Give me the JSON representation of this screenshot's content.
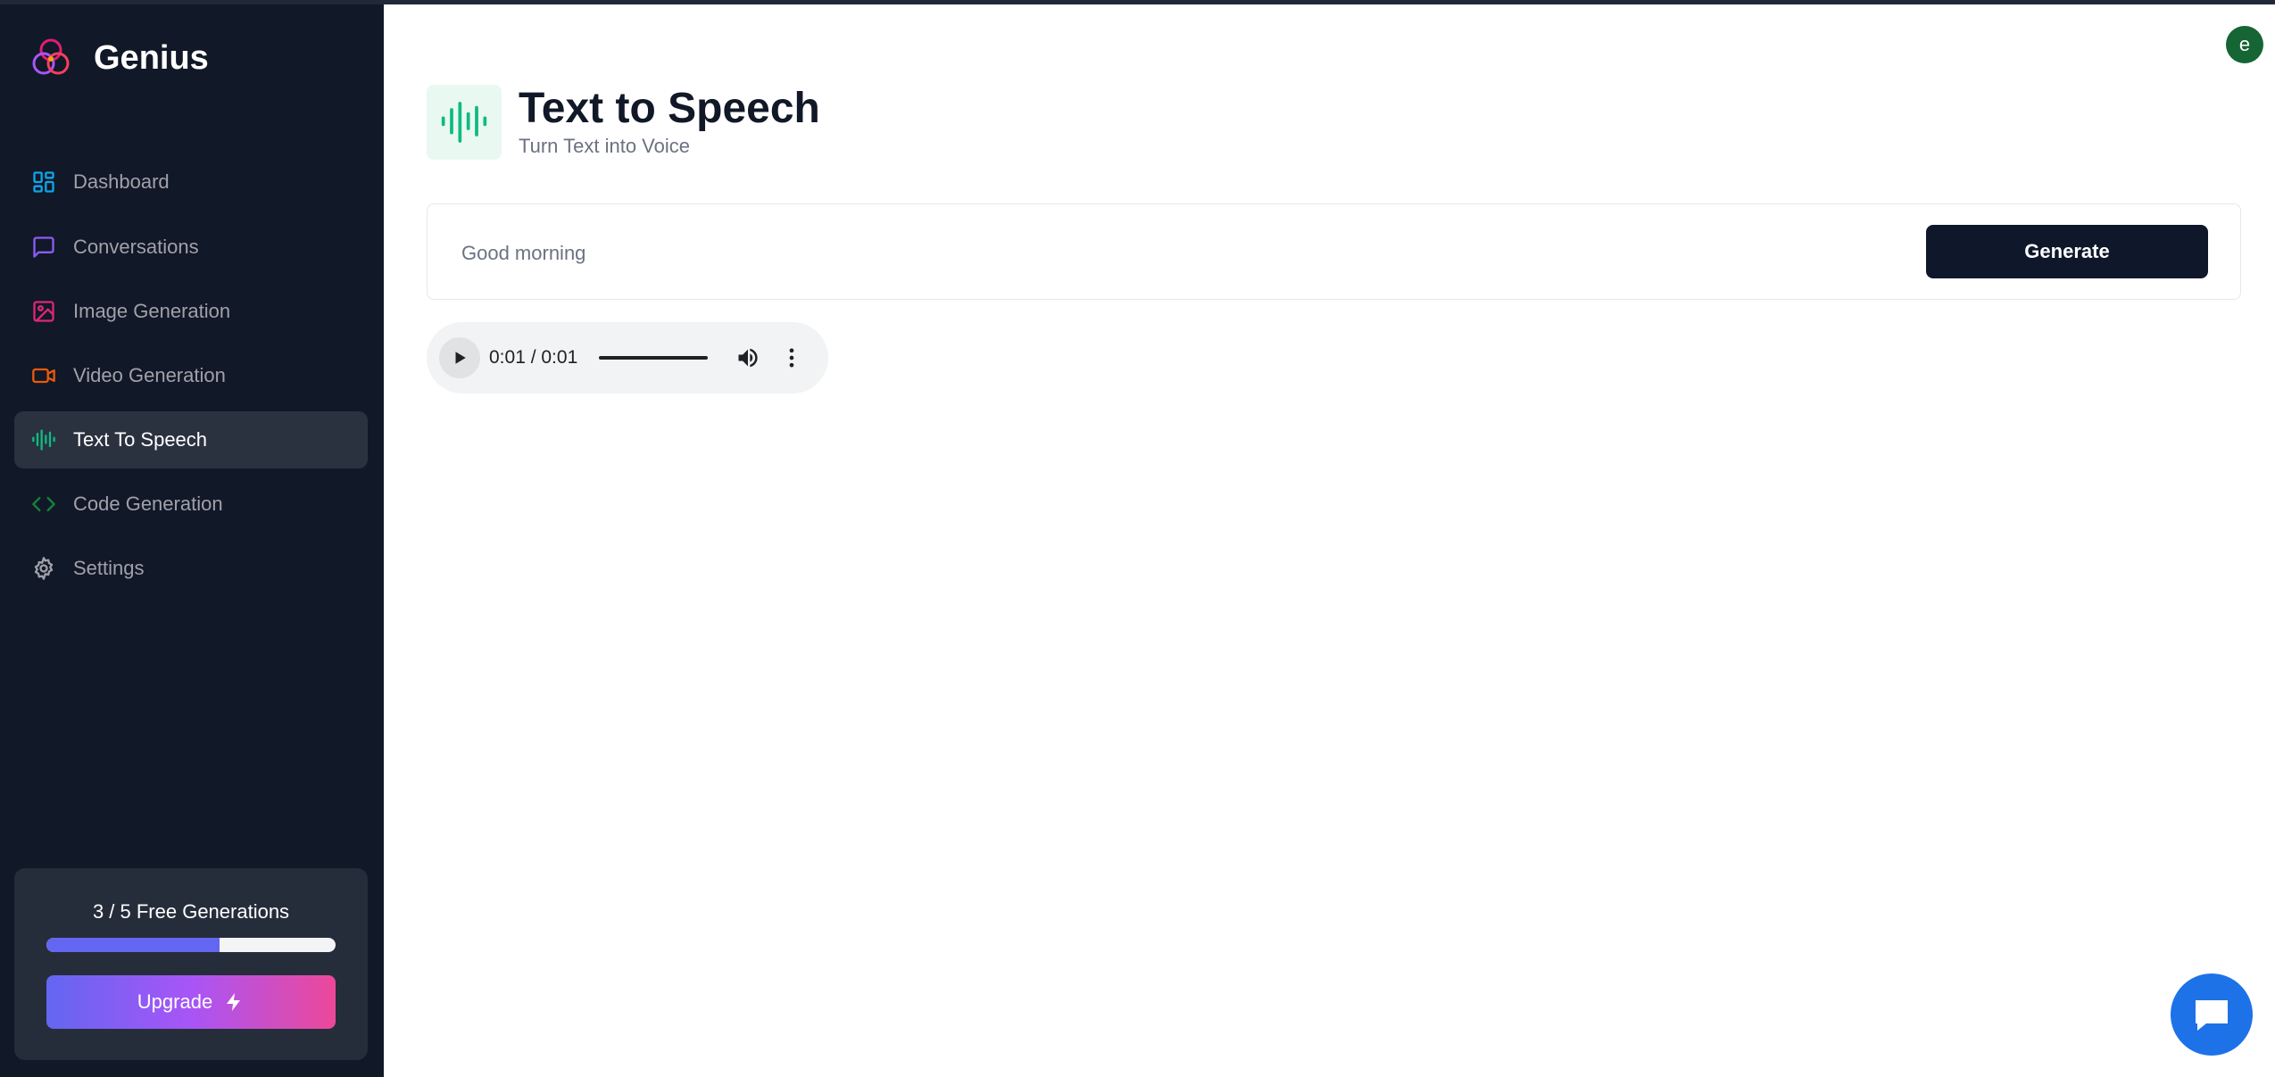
{
  "app": {
    "name": "Genius"
  },
  "sidebar": {
    "items": [
      {
        "label": "Dashboard",
        "icon": "dashboard-icon",
        "color": "#0ea5e9",
        "active": false
      },
      {
        "label": "Conversations",
        "icon": "message-square-icon",
        "color": "#8b5cf6",
        "active": false
      },
      {
        "label": "Image Generation",
        "icon": "image-icon",
        "color": "#db2777",
        "active": false
      },
      {
        "label": "Video Generation",
        "icon": "video-icon",
        "color": "#ea580c",
        "active": false
      },
      {
        "label": "Text To Speech",
        "icon": "audio-wave-icon",
        "color": "#10b981",
        "active": true
      },
      {
        "label": "Code Generation",
        "icon": "code-icon",
        "color": "#15803d",
        "active": false
      },
      {
        "label": "Settings",
        "icon": "gear-icon",
        "color": "#a1a1aa",
        "active": false
      }
    ]
  },
  "free_counter": {
    "label": "3 / 5 Free Generations",
    "used": 3,
    "limit": 5,
    "upgrade_label": "Upgrade"
  },
  "header": {
    "title": "Text to Speech",
    "subtitle": "Turn Text into Voice",
    "icon": "audio-wave-icon",
    "icon_color": "#10b981"
  },
  "form": {
    "prompt_value": "Good morning",
    "generate_label": "Generate"
  },
  "audio": {
    "time": "0:01 / 0:01",
    "progress": 1.0
  },
  "user": {
    "avatar_initial": "e"
  },
  "colors": {
    "sidebar_bg": "#111827",
    "accent": "#6366f1",
    "button_dark": "#0f172a",
    "chat_blue": "#1d72e8"
  }
}
